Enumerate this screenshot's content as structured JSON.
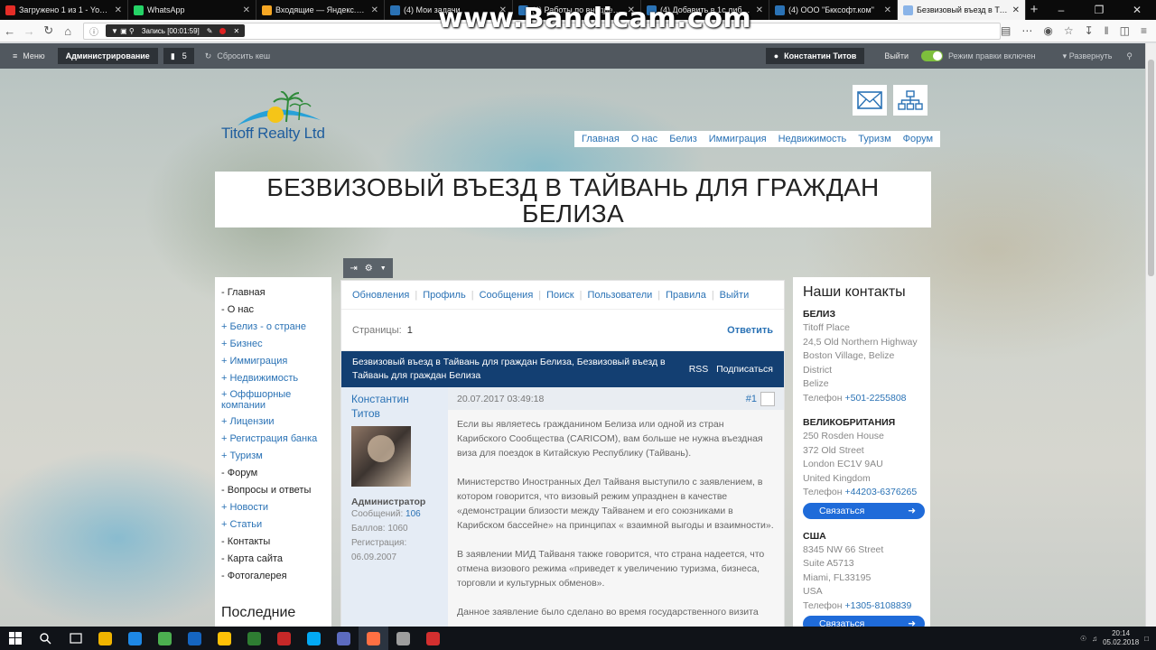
{
  "browser": {
    "tabs": [
      {
        "title": "Загружено 1 из 1 - YouTube",
        "color": "#e52d27"
      },
      {
        "title": "WhatsApp",
        "color": "#25d366"
      },
      {
        "title": "Входящие — Яндекс.Почта",
        "color": "#f5a623"
      },
      {
        "title": "(4) Мои задачи",
        "color": "#2a72b5"
      },
      {
        "title": "(4) Работы по внедрению с",
        "color": "#2a72b5"
      },
      {
        "title": "(4) Добавить в 1с либо указ",
        "color": "#2a72b5"
      },
      {
        "title": "(4) ООО \"Бкксофт.ком\"",
        "color": "#2a72b5"
      },
      {
        "title": "Безвизовый въезд в Тайвань для",
        "color": "#8ab4e8"
      }
    ],
    "record_label": "Запись [00:01:59]",
    "watermark": "www.Bandicam.com"
  },
  "admin": {
    "menu_label": "Меню",
    "admin_label": "Администрирование",
    "count": "5",
    "reset_cache": "Сбросить кеш",
    "user": "Константин Титов",
    "exit": "Выйти",
    "edit_mode": "Режим правки включен",
    "expand": "Развернуть"
  },
  "site": {
    "logo": "Titoff Realty Ltd",
    "nav": [
      "Главная",
      "О нас",
      "Белиз",
      "Иммиграция",
      "Недвижимость",
      "Туризм",
      "Форум"
    ],
    "title_line1": "БЕЗВИЗОВЫЙ ВЪЕЗД В ТАЙВАНЬ ДЛЯ ГРАЖДАН",
    "title_line2": "БЕЛИЗА"
  },
  "sidebar": {
    "items": [
      {
        "label": "- Главная",
        "plus": false
      },
      {
        "label": "- О нас",
        "plus": false
      },
      {
        "label": "+ Белиз - о стране",
        "plus": true
      },
      {
        "label": "+ Бизнес",
        "plus": true
      },
      {
        "label": "+ Иммиграция",
        "plus": true
      },
      {
        "label": "+ Недвижимость",
        "plus": true
      },
      {
        "label": "+ Оффшорные компании",
        "plus": true,
        "wrap": true
      },
      {
        "label": "+ Лицензии",
        "plus": true
      },
      {
        "label": "+ Регистрация банка",
        "plus": true
      },
      {
        "label": "+ Туризм",
        "plus": true
      },
      {
        "label": "- Форум",
        "plus": false
      },
      {
        "label": "- Вопросы и ответы",
        "plus": false
      },
      {
        "label": "+ Новости",
        "plus": true
      },
      {
        "label": "+ Статьи",
        "plus": true
      },
      {
        "label": "- Контакты",
        "plus": false
      },
      {
        "label": "- Карта сайта",
        "plus": false
      },
      {
        "label": "- Фотогалерея",
        "plus": false
      }
    ],
    "latest_heading": "Последние"
  },
  "forum": {
    "menu": [
      "Обновления",
      "Профиль",
      "Сообщения",
      "Поиск",
      "Пользователи",
      "Правила",
      "Выйти"
    ],
    "pages_label": "Страницы:",
    "page_num": "1",
    "reply": "Ответить",
    "thread_title": "Безвизовый въезд в Тайвань для граждан Белиза, Безвизовый въезд в Тайвань для граждан Белиза",
    "rss": "RSS",
    "subscribe": "Подписаться",
    "post": {
      "author": "Константин Титов",
      "role": "Администратор",
      "messages_label": "Сообщений:",
      "messages_count": "106",
      "points": "Баллов: 1060",
      "reg_label": "Регистрация:",
      "reg_date": "06.09.2007",
      "date": "20.07.2017 03:49:18",
      "number": "#1",
      "p1": "Если вы являетесь гражданином Белиза или одной из стран Карибского Сообщества (CARICOM), вам больше не нужна въездная виза для поездок в Китайскую Республику (Тайвань).",
      "p2": "Министерство Иностранных Дел Тайваня выступило с заявлением, в котором говорится, что визовый режим упразднен в качестве «демонстрации близости между Тайванем и его союзниками в Карибском бассейне» на принципах « взаимной выгоды и взаимности».",
      "p3": "В заявлении МИД Тайваня также говорится, что страна надеется, что отмена визового режима «приведет к увеличению туризма, бизнеса, торговли и культурных обменов».",
      "p4": "Данное заявление было сделано во время государственного визита"
    }
  },
  "contacts": {
    "heading": "Наши контакты",
    "belize": {
      "country": "БЕЛИЗ",
      "l1": "Titoff Place",
      "l2": "24,5 Old Northern Highway",
      "l3": "Boston Village, Belize District",
      "l4": "Belize",
      "phone_label": "Телефон",
      "phone": "+501-2255808"
    },
    "uk": {
      "country": "ВЕЛИКОБРИТАНИЯ",
      "l1": "250 Rosden House",
      "l2": "372 Old Street",
      "l3": "London EC1V 9AU",
      "l4": "United Kingdom",
      "phone_label": "Телефон",
      "phone": "+44203-6376265"
    },
    "usa": {
      "country": "США",
      "l1": "8345 NW 66 Street",
      "l2": "Suite A5713",
      "l3": "Miami, FL33195",
      "l4": "USA",
      "phone_label": "Телефон",
      "phone": "+1305-8108839"
    },
    "button": "Связаться"
  },
  "taskbar": {
    "time": "20:14",
    "date": "05.02.2018",
    "apps": [
      "#f0b400",
      "#1e88e5",
      "#4caf50",
      "#1565c0",
      "#ffc107",
      "#2e7d32",
      "#c62828",
      "#03a9f4",
      "#5c6bc0",
      "#ff7043",
      "#9e9e9e",
      "#d32f2f"
    ]
  }
}
